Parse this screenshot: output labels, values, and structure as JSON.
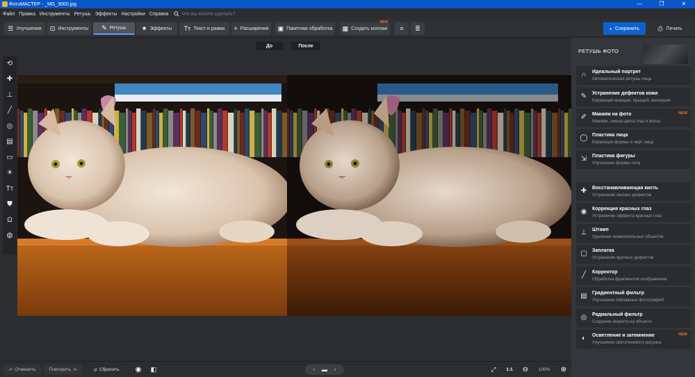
{
  "window": {
    "title": "ФотоМАСТЕР - _MG_3000.jpg",
    "controls": [
      "—",
      "❐",
      "✕"
    ]
  },
  "menu": {
    "items": [
      "Файл",
      "Правка",
      "Инструменты",
      "Ретушь",
      "Эффекты",
      "Настройки",
      "Справка"
    ],
    "search_placeholder": "Что вы хотите сделать?"
  },
  "toolbar": {
    "tabs": [
      {
        "label": "Улучшения",
        "icon": "sliders-icon"
      },
      {
        "label": "Инструменты",
        "icon": "crop-icon"
      },
      {
        "label": "Ретушь",
        "icon": "brush-icon",
        "active": true
      },
      {
        "label": "Эффекты",
        "icon": "sparkle-icon"
      },
      {
        "label": "Текст и рамки",
        "icon": "text-icon"
      },
      {
        "label": "Расширения",
        "icon": "plus-icon"
      }
    ],
    "batch_label": "Пакетная обработка",
    "collage_label": "Создать коллаж",
    "collage_badge": "NEW",
    "save_label": "Сохранить",
    "print_label": "Печать"
  },
  "view": {
    "before_label": "До",
    "after_label": "После"
  },
  "left_tools": [
    {
      "name": "rotate-icon",
      "glyph": "⟲"
    },
    {
      "name": "patch-icon",
      "glyph": "✚"
    },
    {
      "name": "stamp-icon",
      "glyph": "⊥"
    },
    {
      "name": "brush-icon",
      "glyph": "╱"
    },
    {
      "name": "target-icon",
      "glyph": "◎"
    },
    {
      "name": "gradient-icon",
      "glyph": "▤"
    },
    {
      "name": "frame-icon",
      "glyph": "▭"
    },
    {
      "name": "sun-icon",
      "glyph": "☀"
    },
    {
      "name": "text-icon",
      "glyph": "Тт"
    },
    {
      "name": "bucket-icon",
      "glyph": "⛊"
    },
    {
      "name": "face-icon",
      "glyph": "Ω"
    },
    {
      "name": "sphere-icon",
      "glyph": "◍"
    }
  ],
  "bottom": {
    "undo": "Отменить",
    "redo": "Повторить",
    "reset": "Сбросить",
    "ratio": "1:1",
    "zoom": "100%"
  },
  "panel": {
    "title": "РЕТУШЬ ФОТО",
    "items": [
      {
        "title": "Идеальный портрет",
        "sub": "Автоматическая ретушь лица",
        "icon": "portrait-icon",
        "glyph": "∩"
      },
      {
        "title": "Устранение дефектов кожи",
        "sub": "Коррекция морщин, прыщей, веснушек",
        "icon": "skin-icon",
        "glyph": "✎"
      },
      {
        "title": "Макияж на фото",
        "sub": "Макияж, смена цвета глаз и волос",
        "icon": "makeup-icon",
        "glyph": "✐",
        "badge": "NEW"
      },
      {
        "title": "Пластика лица",
        "sub": "Коррекция формы и черт лица",
        "icon": "face-shape-icon",
        "glyph": "◯"
      },
      {
        "title": "Пластика фигуры",
        "sub": "Улучшение формы тела",
        "icon": "figure-icon",
        "glyph": "⇲"
      },
      {
        "title": "Восстанавливающая кисть",
        "sub": "Устранение мелких дефектов",
        "icon": "healing-icon",
        "glyph": "✚"
      },
      {
        "title": "Коррекция красных глаз",
        "sub": "Устранение эффекта красных глаз",
        "icon": "eye-icon",
        "glyph": "◉"
      },
      {
        "title": "Штамп",
        "sub": "Удаление нежелательных объектов",
        "icon": "stamp-icon",
        "glyph": "⊥"
      },
      {
        "title": "Заплатка",
        "sub": "Устранение крупных дефектов",
        "icon": "patch-icon",
        "glyph": "▢"
      },
      {
        "title": "Корректор",
        "sub": "Обработка фрагментов изображения",
        "icon": "corrector-icon",
        "glyph": "╱"
      },
      {
        "title": "Градиентный фильтр",
        "sub": "Улучшение пейзажных фотографий",
        "icon": "gradient-icon",
        "glyph": "▤"
      },
      {
        "title": "Радиальный фильтр",
        "sub": "Создание акцента на объекте",
        "icon": "radial-icon",
        "glyph": "◎"
      },
      {
        "title": "Осветление и затемнение",
        "sub": "Улучшение светотеневого рисунка",
        "icon": "dodge-icon",
        "glyph": "◐",
        "badge": "NEW"
      }
    ]
  },
  "colors": {
    "accent": "#0e62cf",
    "badge": "#ff6a1a"
  }
}
